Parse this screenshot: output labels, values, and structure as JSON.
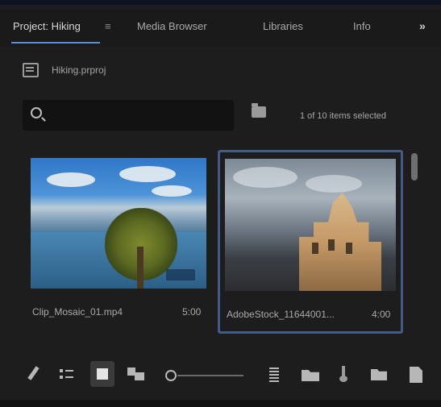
{
  "tabs": [
    {
      "label": "Project: Hiking",
      "active": true
    },
    {
      "label": "Media Browser",
      "active": false
    },
    {
      "label": "Libraries",
      "active": false
    },
    {
      "label": "Info",
      "active": false
    }
  ],
  "tab_menu_glyph": "≡",
  "panel_menu_glyph": "»",
  "project": {
    "file_name": "Hiking.prproj",
    "icon": "project-file-icon"
  },
  "search": {
    "value": "",
    "placeholder": "",
    "icon": "search-icon"
  },
  "bin_button_icon": "bin-icon",
  "items_selected": "1 of 10 items selected",
  "thumbnails": [
    {
      "name": "Clip_Mosaic_01.mp4",
      "duration": "5:00",
      "selected": false
    },
    {
      "name": "AdobeStock_11644001...",
      "duration": "4:00",
      "selected": true
    }
  ],
  "toolbar": {
    "icons": [
      "pencil-icon",
      "list-view-icon",
      "icon-view-icon",
      "freeform-view-icon",
      "zoom-slider",
      "sort-icon",
      "automate-to-sequence-icon",
      "find-icon",
      "new-bin-icon",
      "new-item-icon"
    ],
    "active_view": "icon-view"
  },
  "colors": {
    "accent": "#5a8fd8",
    "selection_border": "#415a86",
    "panel_bg": "#1d1d1d"
  }
}
